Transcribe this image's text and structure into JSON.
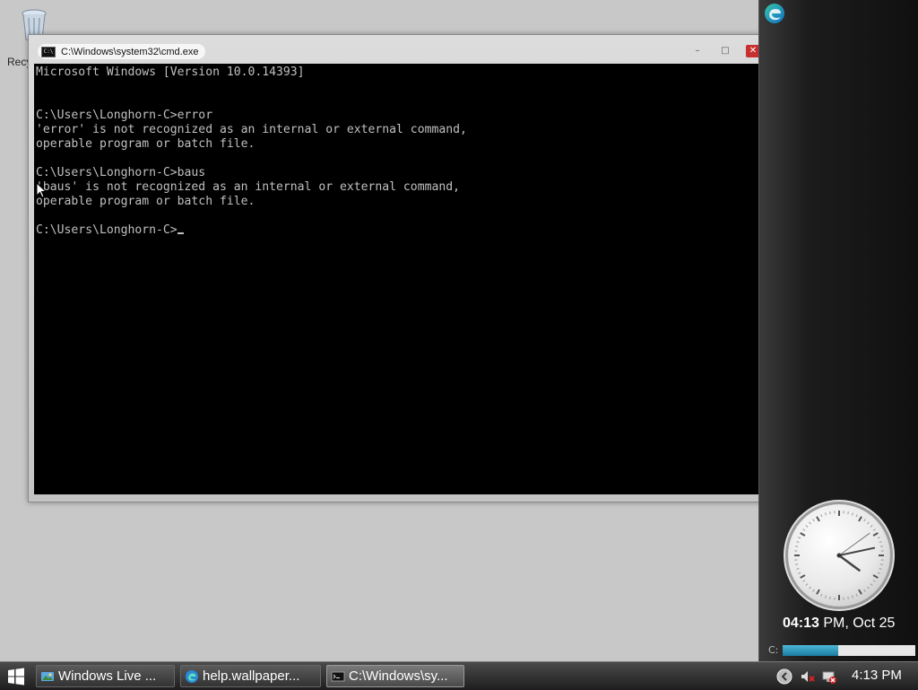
{
  "desktop": {
    "recycle_bin_label": "Recy"
  },
  "cmd_window": {
    "title": "C:\\Windows\\system32\\cmd.exe",
    "icon_label": "C:\\",
    "minimize": "–",
    "maximize": "□",
    "close": "✕",
    "console_lines": [
      "Microsoft Windows [Version 10.0.14393]",
      "",
      "",
      "C:\\Users\\Longhorn-C>error",
      "'error' is not recognized as an internal or external command,",
      "operable program or batch file.",
      "",
      "C:\\Users\\Longhorn-C>baus",
      "'baus' is not recognized as an internal or external command,",
      "operable program or batch file.",
      "",
      "C:\\Users\\Longhorn-C>"
    ]
  },
  "sidebar": {
    "clock_time_bold": "04:13",
    "clock_time_rest": " PM, Oct 25",
    "clock_hands": {
      "hour": 4,
      "minute": 13,
      "second": 9
    },
    "drive_label": "C:",
    "drive_usage_fraction": 0.42
  },
  "taskbar": {
    "items": [
      {
        "label": "Windows Live ...",
        "icon": "photo-gallery-icon",
        "active": false
      },
      {
        "label": "help.wallpaper...",
        "icon": "edge-icon",
        "active": false
      },
      {
        "label": "C:\\Windows\\sy...",
        "icon": "cmd-icon",
        "active": true
      }
    ],
    "time": "4:13 PM"
  }
}
